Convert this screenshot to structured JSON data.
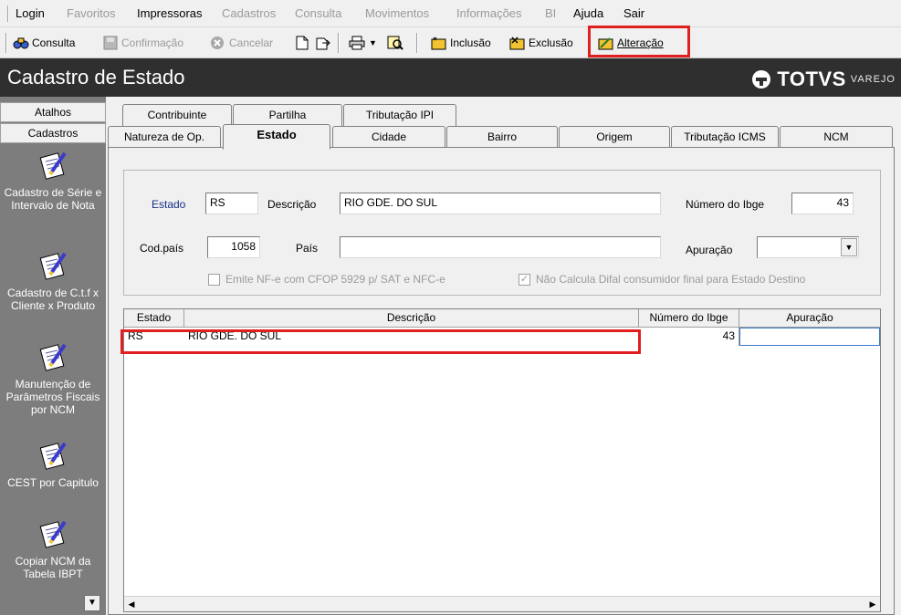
{
  "menu": {
    "items": [
      {
        "label": "Login",
        "enabled": true
      },
      {
        "label": "Favoritos",
        "enabled": false
      },
      {
        "label": "Impressoras",
        "enabled": true
      },
      {
        "label": "Cadastros",
        "enabled": false
      },
      {
        "label": "Consulta",
        "enabled": false
      },
      {
        "label": "Movimentos",
        "enabled": false
      },
      {
        "label": "Informações",
        "enabled": false
      },
      {
        "label": "BI",
        "enabled": false
      },
      {
        "label": "Ajuda",
        "enabled": true
      },
      {
        "label": "Sair",
        "enabled": true
      }
    ]
  },
  "toolbar": {
    "consulta": "Consulta",
    "confirmacao": "Confirmação",
    "cancelar": "Cancelar",
    "inclusao": "Inclusão",
    "exclusao": "Exclusão",
    "alteracao": "Alteração"
  },
  "header": {
    "title": "Cadastro de Estado",
    "brand": "TOTVS",
    "brand_sub": "VAREJO"
  },
  "sidebar": {
    "tab_atalhos": "Atalhos",
    "tab_cadastros": "Cadastros",
    "items": [
      {
        "label": "Cadastro de Série e Intervalo de Nota",
        "icon": "notepad-pencil-icon"
      },
      {
        "label": "Cadastro de C.t.f x Cliente x Produto",
        "icon": "notepad-pencil-icon"
      },
      {
        "label": "Manutenção de Parâmetros Fiscais por NCM",
        "icon": "notepad-pencil-icon"
      },
      {
        "label": "CEST por Capitulo",
        "icon": "notepad-pencil-icon"
      },
      {
        "label": "Copiar NCM da Tabela IBPT",
        "icon": "notepad-pencil-icon"
      }
    ]
  },
  "tabs": {
    "row1": [
      "Contribuinte",
      "Partilha",
      "Tributação IPI"
    ],
    "row2": [
      "Natureza de Op.",
      "Estado",
      "Cidade",
      "Bairro",
      "Origem",
      "Tributação ICMS",
      "NCM"
    ],
    "active": "Estado"
  },
  "form": {
    "estado_label": "Estado",
    "estado_value": "RS",
    "descricao_label": "Descrição",
    "descricao_value": "RIO GDE. DO SUL",
    "ibge_label": "Número do Ibge",
    "ibge_value": "43",
    "codpais_label": "Cod.país",
    "codpais_value": "1058",
    "pais_label": "País",
    "pais_value": "",
    "apuracao_label": "Apuração",
    "apuracao_value": "",
    "chk1_label": "Emite NF-e com CFOP 5929 p/ SAT e NFC-e",
    "chk1_checked": false,
    "chk2_label": "Não Calcula Difal consumidor final para Estado Destino",
    "chk2_checked": true
  },
  "grid": {
    "columns": [
      "Estado",
      "Descrição",
      "Número do Ibge",
      "Apuração"
    ],
    "rows": [
      {
        "estado": "RS",
        "descricao": "RIO GDE. DO SUL",
        "ibge": "43",
        "apuracao": ""
      }
    ]
  },
  "colors": {
    "highlight": "#e0201f",
    "header_bg": "#2f2f2f",
    "sidebar_bg": "#7d7d7d"
  }
}
